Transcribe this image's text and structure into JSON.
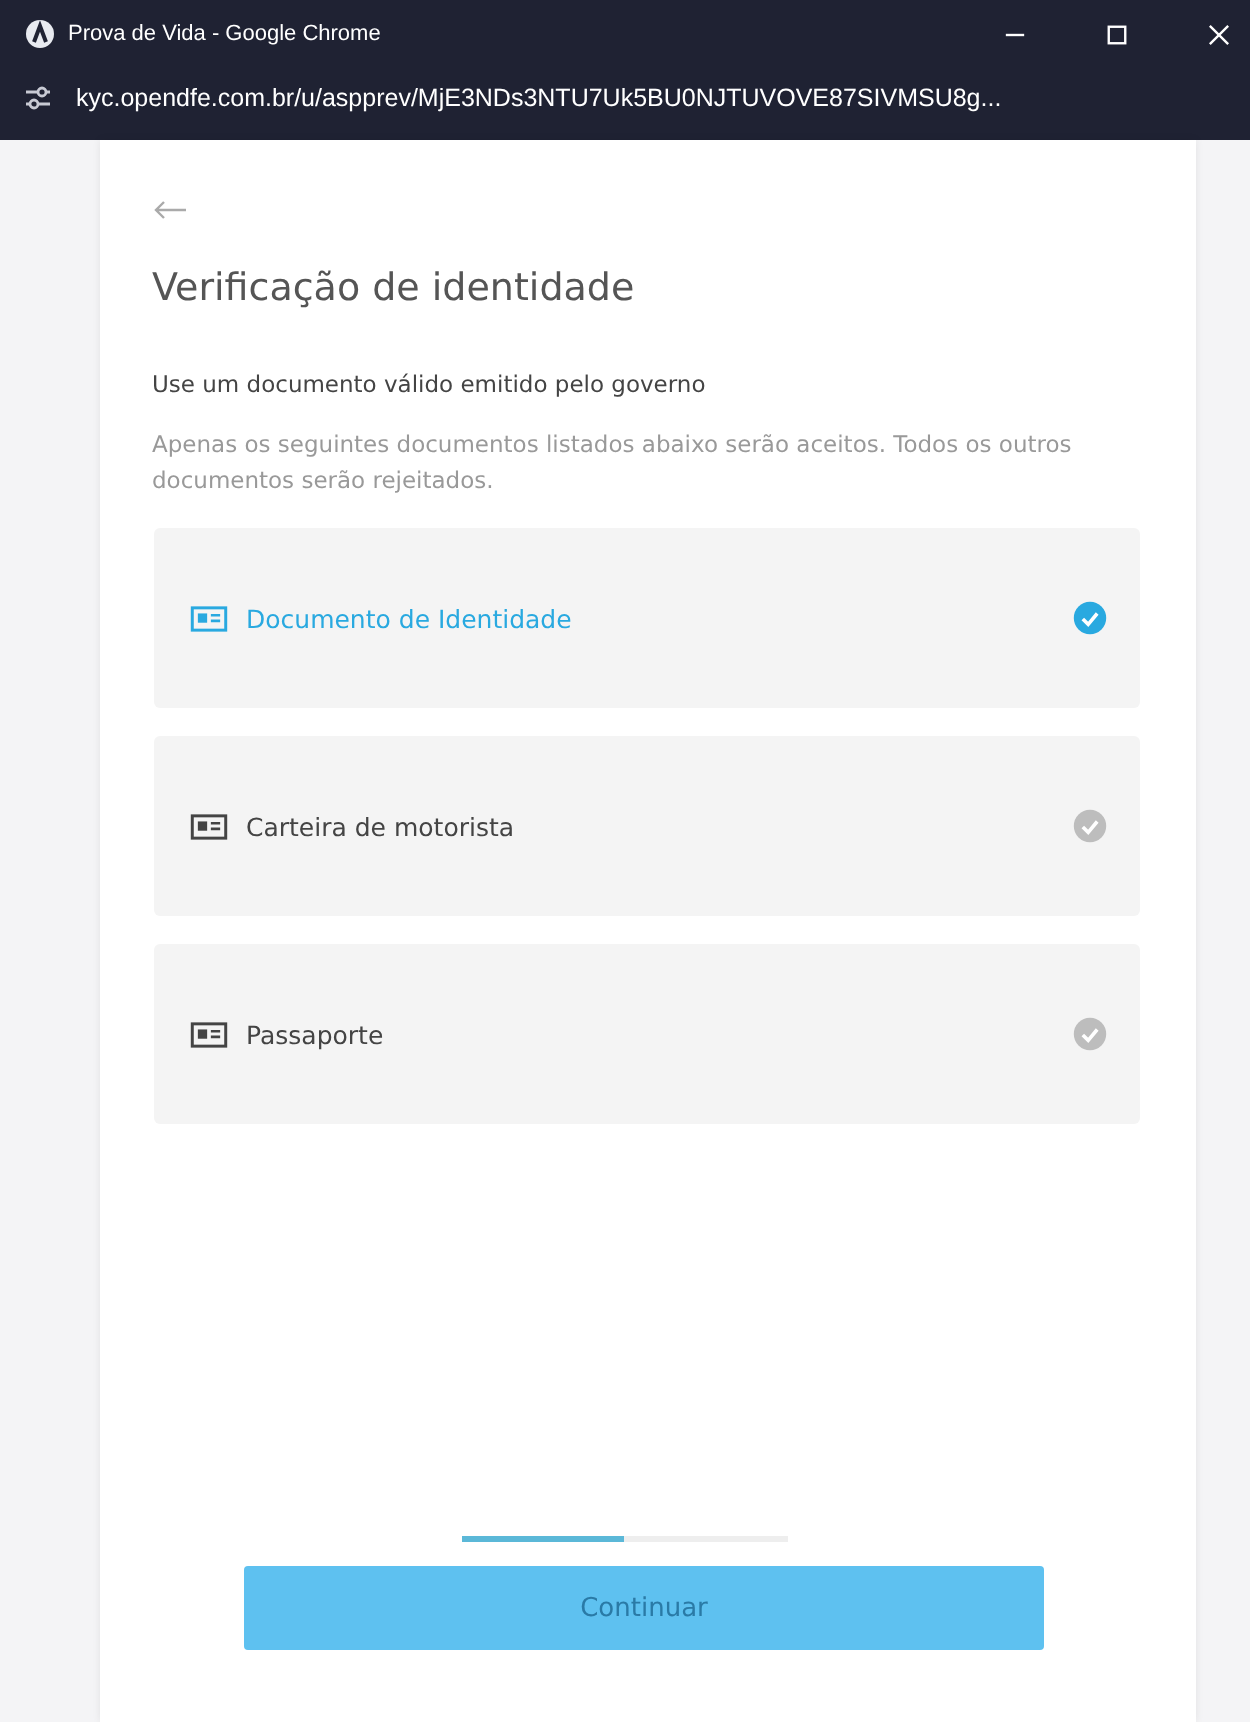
{
  "window": {
    "title": "Prova de Vida - Google Chrome",
    "url": "kyc.opendfe.com.br/u/aspprev/MjE3NDs3NTU7Uk5BU0NJTUVOVE87SIVMSU8g..."
  },
  "page": {
    "title": "Verificação de identidade",
    "subtitle": "Use um documento válido emitido pelo governo",
    "note": "Apenas os seguintes documentos listados abaixo serão aceitos. Todos os outros documentos serão rejeitados."
  },
  "documents": [
    {
      "label": "Documento de Identidade",
      "selected": true
    },
    {
      "label": "Carteira de motorista",
      "selected": false
    },
    {
      "label": "Passaporte",
      "selected": false
    }
  ],
  "progress": {
    "level": 0.5
  },
  "button": "Continuar"
}
